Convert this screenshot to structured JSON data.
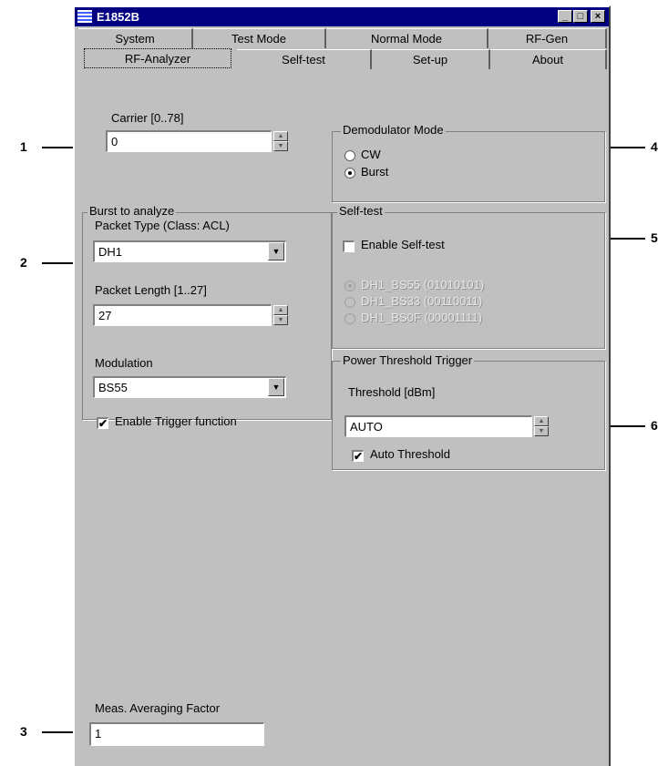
{
  "window": {
    "title": "E1852B",
    "minimize": "_",
    "maximize": "□",
    "close": "×"
  },
  "tabs": {
    "row1": [
      "System",
      "Test Mode",
      "Normal Mode",
      "RF-Gen"
    ],
    "row2": [
      "RF-Analyzer",
      "Self-test",
      "Set-up",
      "About"
    ],
    "active": "RF-Analyzer"
  },
  "carrier": {
    "label": "Carrier [0..78]",
    "value": "0"
  },
  "demodulator": {
    "title": "Demodulator Mode",
    "options": [
      "CW",
      "Burst"
    ],
    "selected": "Burst"
  },
  "burst": {
    "title": "Burst to analyze",
    "packet_type_label": "Packet Type (Class: ACL)",
    "packet_type_value": "DH1",
    "packet_length_label": "Packet Length [1..27]",
    "packet_length_value": "27",
    "modulation_label": "Modulation",
    "modulation_value": "BS55",
    "trigger_label": "Enable Trigger function",
    "trigger_checked": true
  },
  "selftest": {
    "title": "Self-test",
    "enable_label": "Enable Self-test",
    "enable_checked": false,
    "options": [
      "DH1_BS55 (01010101)",
      "DH1_BS33 (00110011)",
      "DH1_BS0F (00001111)"
    ],
    "selected": "DH1_BS55 (01010101)"
  },
  "power": {
    "title": "Power Threshold Trigger",
    "threshold_label": "Threshold [dBm]",
    "threshold_value": "AUTO",
    "auto_label": "Auto Threshold",
    "auto_checked": true
  },
  "averaging": {
    "label": "Meas. Averaging Factor",
    "value": "1"
  },
  "callouts": [
    "1",
    "2",
    "3",
    "4",
    "5",
    "6"
  ],
  "icons": {
    "spin_up": "▲",
    "spin_down": "▼",
    "dropdown": "▼",
    "check": "✔"
  }
}
